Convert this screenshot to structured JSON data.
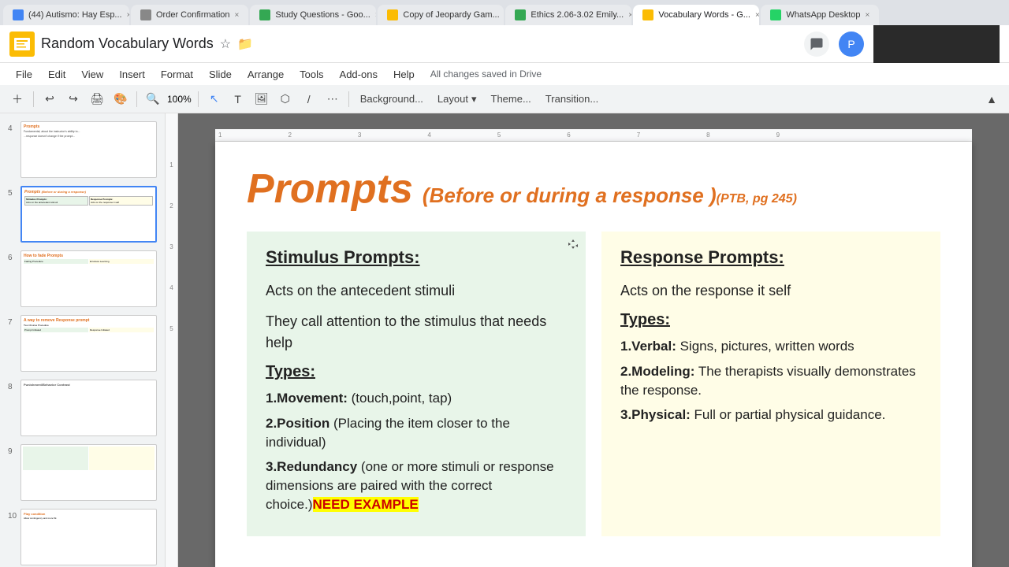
{
  "browser": {
    "tabs": [
      {
        "label": "(44) Autismo: Hay Esp...",
        "active": false
      },
      {
        "label": "Order Confirmation",
        "active": false
      },
      {
        "label": "Study Questions - Goo...",
        "active": false
      },
      {
        "label": "Copy of Jeopardy Gam...",
        "active": false
      },
      {
        "label": "Ethics 2.06-3.02 Emily...",
        "active": false
      },
      {
        "label": "Vocabulary Words - G...",
        "active": true
      },
      {
        "label": "WhatsApp Desktop",
        "active": false
      }
    ]
  },
  "header": {
    "title": "Random Vocabulary Words",
    "autosave": "All changes saved in Drive"
  },
  "menu": {
    "items": [
      "File",
      "Edit",
      "View",
      "Insert",
      "Format",
      "Slide",
      "Arrange",
      "Tools",
      "Add-ons",
      "Help"
    ]
  },
  "toolbar": {
    "background_label": "Background...",
    "layout_label": "Layout",
    "theme_label": "Theme...",
    "transition_label": "Transition..."
  },
  "slides": [
    {
      "num": "4",
      "active": false
    },
    {
      "num": "5",
      "active": true
    },
    {
      "num": "6",
      "active": false
    },
    {
      "num": "7",
      "active": false
    },
    {
      "num": "8",
      "active": false
    },
    {
      "num": "9",
      "active": false
    },
    {
      "num": "10",
      "active": false
    }
  ],
  "slide": {
    "title": "Prompts",
    "subtitle": "(Before or during a response )",
    "ref": "(PTB, pg 245)",
    "left_col": {
      "heading": "Stimulus Prompts:",
      "text1": "Acts on the antecedent stimuli",
      "text2": "They call attention to the stimulus that needs help",
      "types_heading": "Types:",
      "items": [
        {
          "bold": "1.Movement:",
          "rest": " (touch,point, tap)"
        },
        {
          "bold": "2.Position",
          "rest": " (Placing the item closer to the individual)"
        },
        {
          "bold": "3.Redundancy",
          "rest": " (one or more stimuli or response dimensions are paired with the correct choice.)"
        },
        {
          "highlight": "NEED EXAMPLE"
        }
      ]
    },
    "right_col": {
      "heading": "Response Prompts:",
      "text1": "Acts on the response it self",
      "types_heading": "Types:",
      "items": [
        {
          "bold": "1.Verbal:",
          "rest": " Signs, pictures, written words"
        },
        {
          "bold": "2.Modeling:",
          "rest": " The therapists visually demonstrates the response."
        },
        {
          "bold": "3.Physical:",
          "rest": " Full or partial physical guidance."
        }
      ]
    }
  }
}
